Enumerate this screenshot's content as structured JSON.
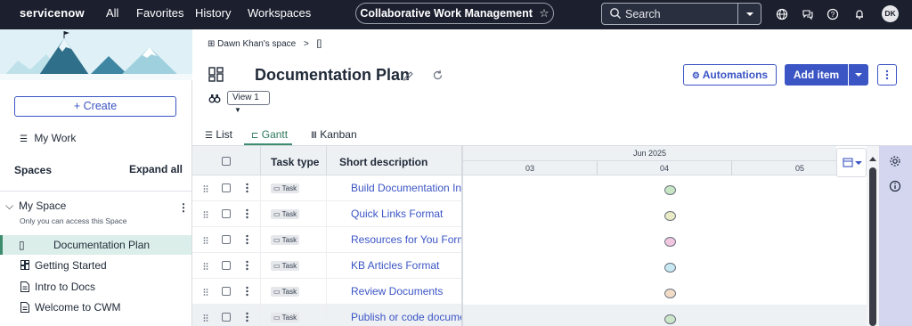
{
  "topbar": {
    "logo": "servicenow",
    "nav": [
      "All",
      "Favorites",
      "History",
      "Workspaces"
    ],
    "context": "Collaborative Work Management",
    "search_placeholder": "Search",
    "avatar_initials": "DK",
    "icons": [
      "star-icon",
      "search-icon",
      "chevron-down-icon",
      "globe-icon",
      "chat-icon",
      "help-icon",
      "bell-icon"
    ]
  },
  "sidebar": {
    "create_label": "Create",
    "my_work_label": "My Work",
    "spaces_label": "Spaces",
    "expand_all_label": "Expand all",
    "my_space": {
      "title": "My Space",
      "subtitle": "Only you can access this Space"
    },
    "items": [
      {
        "label": "Documentation Plan",
        "icon": "document-placeholder-icon",
        "active": true
      },
      {
        "label": "Getting Started",
        "icon": "board-icon"
      },
      {
        "label": "Intro to Docs",
        "icon": "page-icon"
      },
      {
        "label": "Welcome to CWM",
        "icon": "page-icon"
      }
    ]
  },
  "main": {
    "breadcrumb": {
      "space": "Dawn Khan's space",
      "separator": ">",
      "current": "[]"
    },
    "title": "Documentation Plan",
    "view_label": "View 1",
    "automations_label": "Automations",
    "add_item_label": "Add item",
    "tabs": [
      {
        "label": "List",
        "active": false
      },
      {
        "label": "Gantt",
        "active": true
      },
      {
        "label": "Kanban",
        "active": false
      }
    ],
    "grid": {
      "col_task_type": "Task type",
      "col_short_description": "Short description",
      "rows": [
        {
          "type": "Task",
          "desc": "Build Documentation Inventory",
          "dot_color": "#c9e6c4"
        },
        {
          "type": "Task",
          "desc": "Quick Links Format",
          "dot_color": "#e8ebc4"
        },
        {
          "type": "Task",
          "desc": "Resources for You Format",
          "dot_color": "#f1c6df"
        },
        {
          "type": "Task",
          "desc": "KB Articles Format",
          "dot_color": "#c8e9f2"
        },
        {
          "type": "Task",
          "desc": "Review Documents",
          "dot_color": "#f3dcc6"
        },
        {
          "type": "Task",
          "desc": "Publish or code documents",
          "dot_color": "#cce6c8"
        }
      ]
    },
    "gantt": {
      "month": "Jun 2025",
      "days": [
        "03",
        "04",
        "05"
      ]
    }
  }
}
